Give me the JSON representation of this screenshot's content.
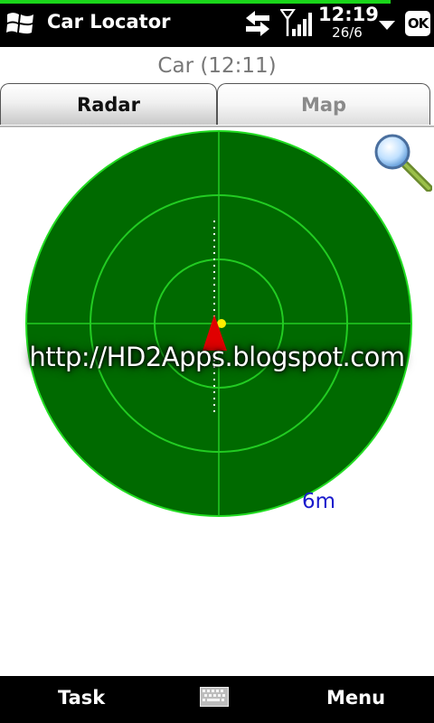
{
  "statusbar": {
    "app_title": "Car Locator",
    "time": "12:19",
    "date": "26/6",
    "ok_label": "OK",
    "icons": [
      "windows-start-icon",
      "sync-icon",
      "signal-icon",
      "dropdown-arrow-icon"
    ]
  },
  "subtitle": "Car (12:11)",
  "tabs": [
    {
      "label": "Radar",
      "active": true
    },
    {
      "label": "Map",
      "active": false
    }
  ],
  "radar": {
    "rings": 3,
    "scale_label": "6m",
    "watermark": "http://HD2Apps.blogspot.com",
    "colors": {
      "background": "#006a00",
      "lines": "#22dd22",
      "user_marker": "#e00000",
      "car_marker": "#ffee00",
      "path": "#ffffff"
    }
  },
  "menubar": {
    "left_label": "Task",
    "right_label": "Menu",
    "center_icon": "keyboard-icon"
  }
}
